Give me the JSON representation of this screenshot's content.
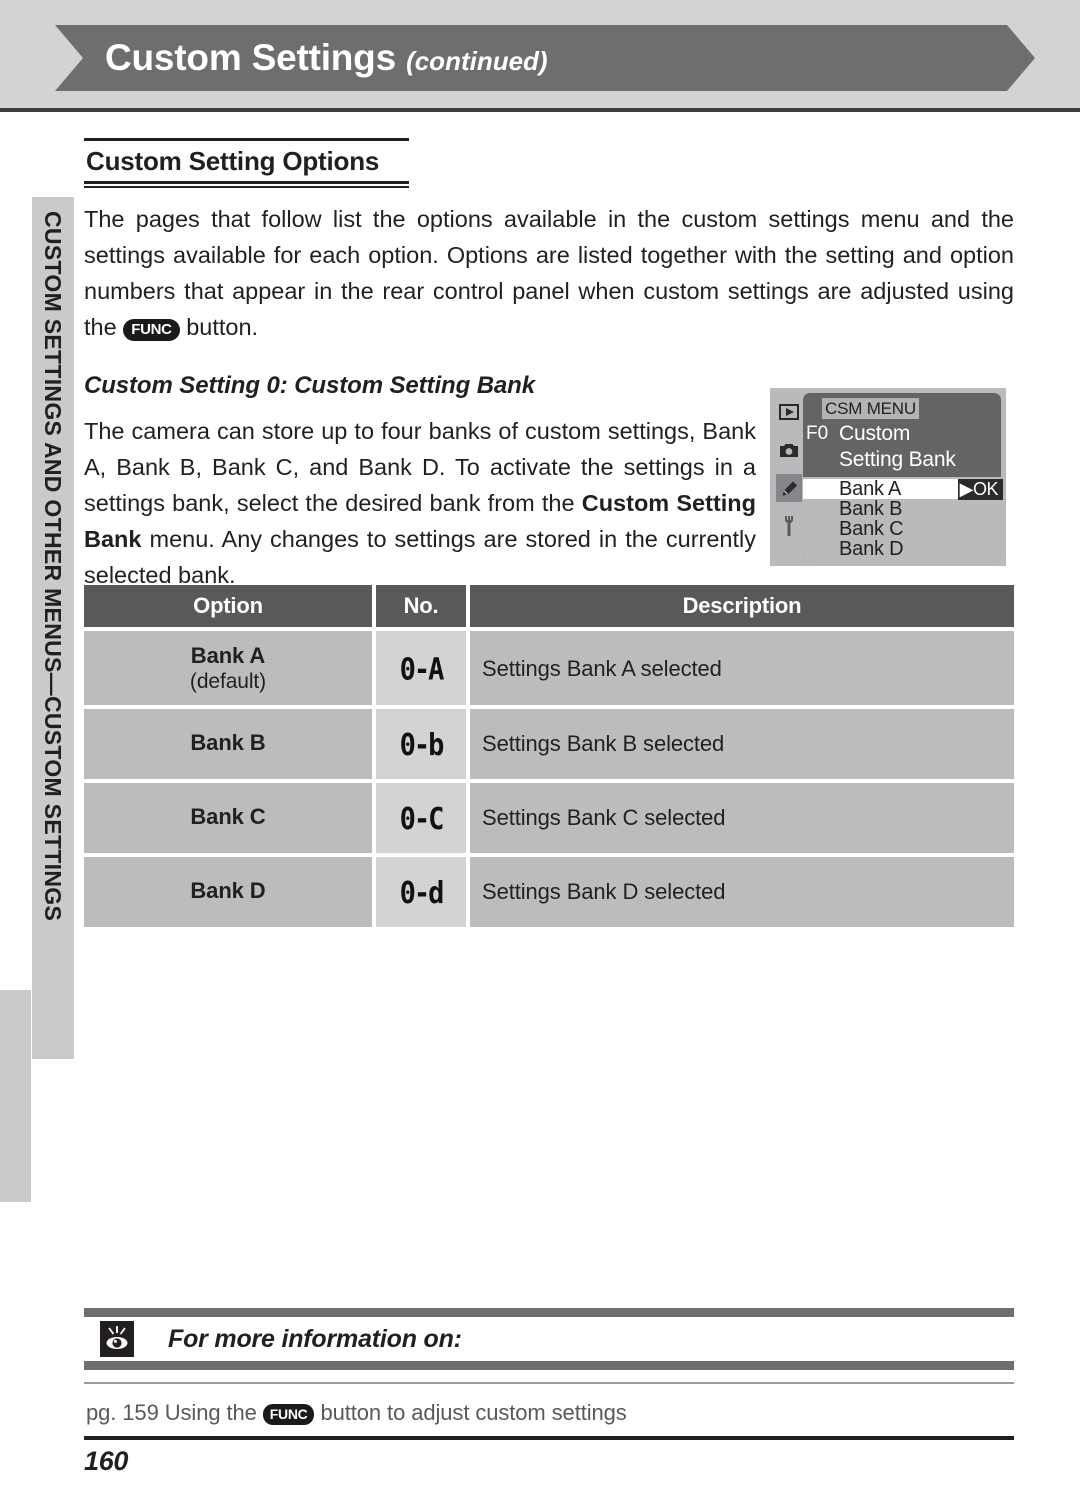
{
  "header": {
    "title": "Custom Settings",
    "continued": "(continued)"
  },
  "sidebar": {
    "tab_label": "CUSTOM SETTINGS AND OTHER MENUS—CUSTOM SETTINGS"
  },
  "main": {
    "section_heading": "Custom Setting Options",
    "intro_part1": "The pages that follow list the options available in the custom settings menu and the settings available for each option.  Options are listed together with the setting and option numbers that appear in the rear control panel when custom settings are adjusted using the ",
    "func_label": "FUNC",
    "intro_part2": " button.",
    "subheading": "Custom Setting 0: Custom Setting Bank",
    "body_part1": "The camera can store up to four banks of custom settings, Bank A, Bank B, Bank C, and Bank D. To activate the settings in a settings bank, select the desired bank from the ",
    "body_bold": "Custom Setting Bank",
    "body_part2": " menu.  Any changes to settings are stored in the currently selected bank."
  },
  "lcd": {
    "title": "CSM MENU",
    "setting_no": "F0",
    "setting_name_line1": "Custom",
    "setting_name_line2": "Setting Bank",
    "ok_label": "OK",
    "items": [
      {
        "label": "Bank A",
        "selected": true
      },
      {
        "label": "Bank B",
        "selected": false
      },
      {
        "label": "Bank C",
        "selected": false
      },
      {
        "label": "Bank D",
        "selected": false
      }
    ],
    "icons": [
      "playback-icon",
      "camera-icon",
      "pencil-icon",
      "wrench-icon"
    ]
  },
  "table": {
    "headers": {
      "option": "Option",
      "no": "No.",
      "description": "Description"
    },
    "rows": [
      {
        "option": "Bank A",
        "default_note": "(default)",
        "no": "0-A",
        "description": "Settings Bank A selected"
      },
      {
        "option": "Bank B",
        "default_note": "",
        "no": "0-b",
        "description": "Settings Bank B selected"
      },
      {
        "option": "Bank C",
        "default_note": "",
        "no": "0-C",
        "description": "Settings Bank C selected"
      },
      {
        "option": "Bank D",
        "default_note": "",
        "no": "0-d",
        "description": "Settings Bank D selected"
      }
    ]
  },
  "footer": {
    "heading": "For more information on:",
    "ref_prefix": "pg. 159  Using the ",
    "ref_func": "FUNC",
    "ref_suffix": " button to adjust custom settings",
    "page_number": "160"
  },
  "colors": {
    "banner": "#6e6e70",
    "banner_band": "#d2d3d5",
    "table_header": "#58595b",
    "table_cell": "#bbbcbe",
    "table_no_cell": "#d2d3d5",
    "lcd_dark": "#636466",
    "lcd_light": "#b9babc"
  }
}
